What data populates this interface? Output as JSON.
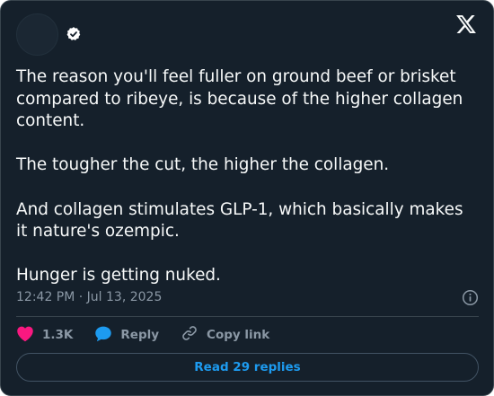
{
  "tweet": {
    "text": "The reason you'll feel fuller on ground beef or brisket compared to ribeye, is because of the higher collagen content.\n\nThe tougher the cut, the higher the collagen.\n\nAnd collagen stimulates GLP-1, which basically makes it nature's ozempic.\n\nHunger is getting nuked.",
    "timestamp": "12:42 PM · Jul 13, 2025"
  },
  "actions": {
    "like_count": "1.3K",
    "reply_label": "Reply",
    "copy_link_label": "Copy link"
  },
  "read_replies_label": "Read 29 replies",
  "icons": {
    "logo": "x-logo-icon",
    "verified": "verified-badge-icon",
    "info": "info-icon",
    "like": "heart-icon",
    "reply": "speech-bubble-icon",
    "copy_link": "link-icon"
  },
  "colors": {
    "background": "#15202b",
    "text": "#f7f9f9",
    "muted": "#8b98a5",
    "like": "#f91880",
    "reply": "#1d9bf0",
    "accent": "#1d9bf0"
  }
}
